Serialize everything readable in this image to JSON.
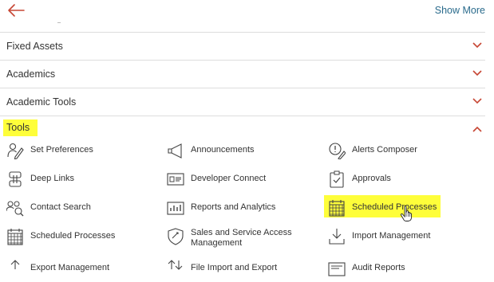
{
  "header": {
    "show_more": "Show More"
  },
  "sections": [
    {
      "label": "Fixed Assets"
    },
    {
      "label": "Academics"
    },
    {
      "label": "Academic Tools"
    },
    {
      "label": "Tools",
      "expanded": true
    }
  ],
  "tools": {
    "items": [
      {
        "label": "Set Preferences",
        "icon": "user-pen-icon"
      },
      {
        "label": "Announcements",
        "icon": "megaphone-icon"
      },
      {
        "label": "Alerts Composer",
        "icon": "alert-composer-icon"
      },
      {
        "label": "Deep Links",
        "icon": "deep-links-icon"
      },
      {
        "label": "Developer Connect",
        "icon": "developer-connect-icon"
      },
      {
        "label": "Approvals",
        "icon": "clipboard-check-icon"
      },
      {
        "label": "Contact Search",
        "icon": "contact-search-icon"
      },
      {
        "label": "Reports and Analytics",
        "icon": "report-chart-icon"
      },
      {
        "label": "Scheduled Processes",
        "icon": "calendar-icon",
        "highlighted": true
      },
      {
        "label": "Scheduled Processes",
        "icon": "calendar-icon"
      },
      {
        "label": "Sales and Service Access Management",
        "icon": "shield-icon"
      },
      {
        "label": "Import Management",
        "icon": "import-tray-icon"
      },
      {
        "label": "Export Management",
        "icon": "export-icon"
      },
      {
        "label": "File Import and Export",
        "icon": "file-transfer-icon"
      },
      {
        "label": "Audit Reports",
        "icon": "audit-report-icon"
      }
    ]
  },
  "colors": {
    "accent": "#c74634",
    "highlight": "#fefe3a",
    "link": "#2a6b8c",
    "divider": "#dddddd"
  }
}
